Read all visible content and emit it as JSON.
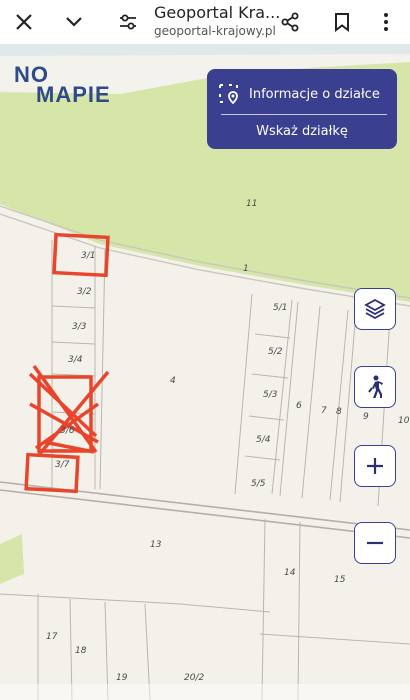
{
  "browser": {
    "title": "Geoportal Kra...",
    "url": "geoportal-krajowy.pl"
  },
  "logo": {
    "line1": "NO",
    "line2": "MAPIE"
  },
  "panel": {
    "info_label": "Informacje o działce",
    "point_label": "Wskaż działkę"
  },
  "map": {
    "labels": [
      {
        "name": "plot-11",
        "text": "11"
      },
      {
        "name": "plot-1",
        "text": "1"
      },
      {
        "name": "plot-3-1",
        "text": "3/1"
      },
      {
        "name": "plot-3-2",
        "text": "3/2"
      },
      {
        "name": "plot-3-3",
        "text": "3/3"
      },
      {
        "name": "plot-3-4",
        "text": "3/4"
      },
      {
        "name": "plot-3-6",
        "text": "3/6"
      },
      {
        "name": "plot-3-7",
        "text": "3/7"
      },
      {
        "name": "plot-4",
        "text": "4"
      },
      {
        "name": "plot-5-1",
        "text": "5/1"
      },
      {
        "name": "plot-5-2",
        "text": "5/2"
      },
      {
        "name": "plot-5-3",
        "text": "5/3"
      },
      {
        "name": "plot-5-4",
        "text": "5/4"
      },
      {
        "name": "plot-5-5",
        "text": "5/5"
      },
      {
        "name": "plot-6",
        "text": "6"
      },
      {
        "name": "plot-7",
        "text": "7"
      },
      {
        "name": "plot-8",
        "text": "8"
      },
      {
        "name": "plot-9",
        "text": "9"
      },
      {
        "name": "plot-10",
        "text": "10"
      },
      {
        "name": "plot-13",
        "text": "13"
      },
      {
        "name": "plot-14",
        "text": "14"
      },
      {
        "name": "plot-15",
        "text": "15"
      },
      {
        "name": "plot-17",
        "text": "17"
      },
      {
        "name": "plot-18",
        "text": "18"
      },
      {
        "name": "plot-19",
        "text": "19"
      },
      {
        "name": "plot-20-2",
        "text": "20/2"
      }
    ]
  },
  "colors": {
    "accent": "#3b3f8f",
    "highlight": "#e8452c",
    "green_area": "#d6e6a9",
    "water": "#dfe9e9"
  },
  "icons": {
    "close": "close-icon",
    "dropdown": "chevron-down-icon",
    "tune": "tune-icon",
    "share": "share-icon",
    "bookmark": "bookmark-icon",
    "more": "more-vert-icon",
    "select": "select-parcel-icon",
    "layers": "layers-icon",
    "pedestrian": "pedestrian-icon",
    "zoom_in": "plus-icon",
    "zoom_out": "minus-icon"
  }
}
